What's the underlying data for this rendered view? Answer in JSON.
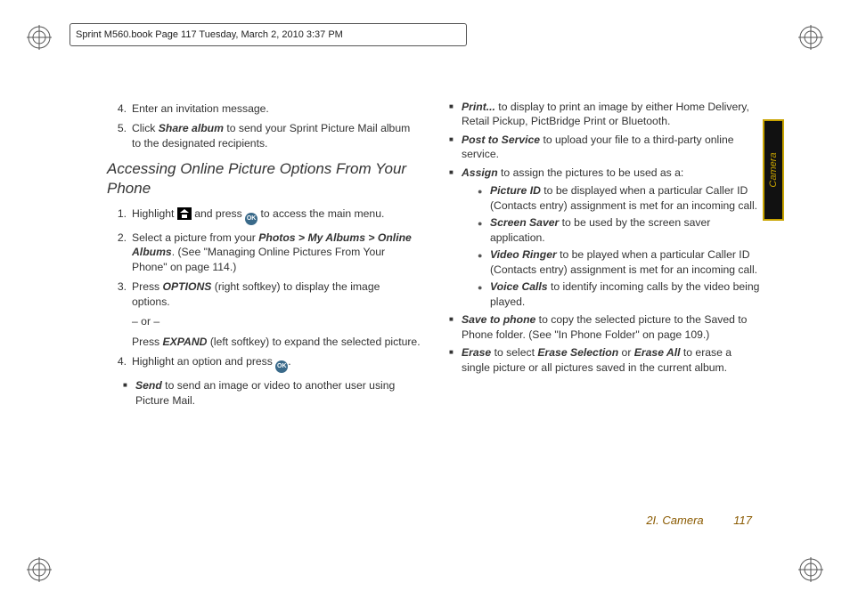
{
  "crop_header": "Sprint M560.book  Page 117  Tuesday, March 2, 2010  3:37 PM",
  "left": {
    "step4": "Enter an invitation message.",
    "step5_a": "Click ",
    "step5_b": "Share album",
    "step5_c": " to send your Sprint Picture Mail album to the designated recipients.",
    "subhead": "Accessing Online Picture Options From Your Phone",
    "n1_a": "Highlight ",
    "n1_b": " and press ",
    "n1_c": " to access the main menu.",
    "n2_a": "Select a picture from your ",
    "n2_p": "Photos > My Albums > Online Albums",
    "n2_b": ". (See \"Managing Online Pictures From Your Phone\" on page 114.)",
    "n3_a": "Press ",
    "n3_opt": "OPTIONS",
    "n3_b": " (right softkey) to display the image options.",
    "or": "– or –",
    "n3_c": "Press ",
    "n3_exp": "EXPAND",
    "n3_d": " (left softkey) to expand the selected picture.",
    "n4_a": "Highlight an option and press ",
    "n4_b": ".",
    "send_k": "Send",
    "send_t": " to send an image or video to another user using Picture Mail."
  },
  "right": {
    "print_k": "Print...",
    "print_t": " to display to print an image by either Home Delivery, Retail Pickup, PictBridge Print or Bluetooth.",
    "post_k": "Post to Service",
    "post_t": " to upload your file to a third-party online service.",
    "assign_k": "Assign",
    "assign_t": " to assign the pictures to be used as a:",
    "pid_k": "Picture ID",
    "pid_t": " to be displayed when a particular Caller ID (Contacts entry) assignment is met for an incoming call.",
    "ss_k": "Screen Saver",
    "ss_t": " to be used by the screen saver application.",
    "vr_k": "Video Ringer",
    "vr_t": " to be played when a particular Caller ID (Contacts entry) assignment is met for an incoming call.",
    "vc_k": "Voice Calls",
    "vc_t": " to identify incoming calls by the video being played.",
    "save_k": "Save to phone",
    "save_t": " to copy the selected picture to the Saved to Phone folder. (See \"In Phone Folder\" on page 109.)",
    "erase_k": "Erase",
    "erase_a": " to select ",
    "erase_sel": "Erase Selection",
    "erase_b": " or ",
    "erase_all": "Erase All",
    "erase_c": " to erase a single picture or all pictures saved in the current album."
  },
  "footer_section": "2I. Camera",
  "footer_page": "117",
  "side_tab": "Camera",
  "ok_label": "OK"
}
